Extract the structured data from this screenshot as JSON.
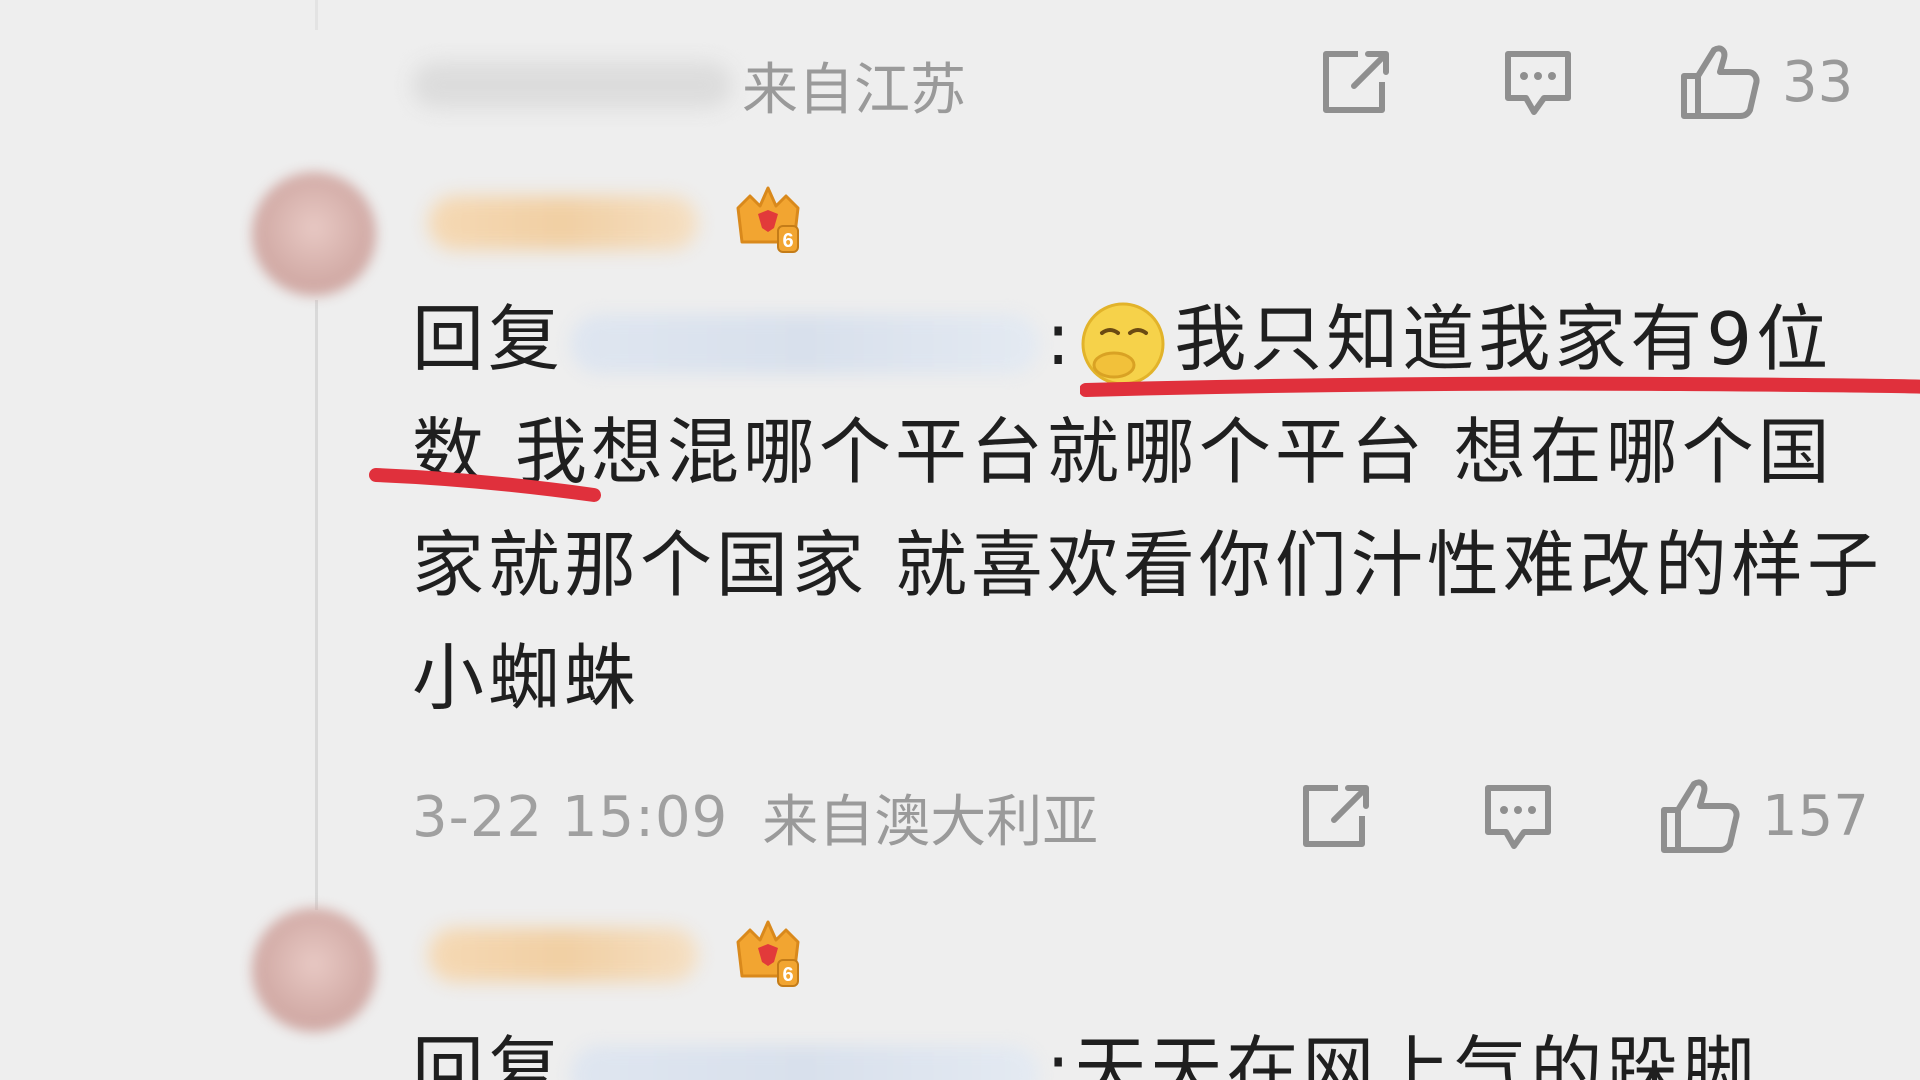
{
  "top_comment": {
    "location": "来自江苏",
    "like_count": "33"
  },
  "reply": {
    "reply_prefix": "回复",
    "colon": ":",
    "text_line1": "我只知道我家有9",
    "text_rest": "位数 我想混哪个平台就哪个平台 想在哪个国家就那个国家 就喜欢看你们汁性难改的样子 小蜘蛛",
    "time": "3-22 15:09",
    "location": "来自澳大利亚",
    "like_count": "157",
    "badge_level": "6"
  },
  "next_reply": {
    "reply_prefix": "回复",
    "text_partial": ":天天在网上气的跺脚",
    "badge_level": "6"
  },
  "icons": [
    "share-icon",
    "comment-icon",
    "like-icon",
    "crown-badge-icon",
    "emoji-icon"
  ],
  "colors": {
    "background": "#eeeeee",
    "text": "#1f1f1f",
    "meta": "#9a9a9a",
    "underline": "#e0303c",
    "crown": "#f2a531"
  }
}
